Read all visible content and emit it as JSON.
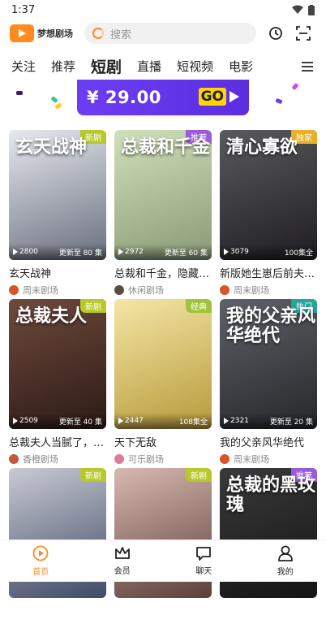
{
  "status": {
    "time": "1:37"
  },
  "header": {
    "logo_text": "梦想剧场",
    "search_placeholder": "搜索"
  },
  "tabs": [
    "关注",
    "推荐",
    "短剧",
    "直播",
    "短视频",
    "电影"
  ],
  "active_tab": "短剧",
  "banner": {
    "price": "¥ 29.00",
    "go_label": "GO"
  },
  "cards": [
    {
      "title": "玄天战神",
      "poster_text": "玄天战神",
      "badge": "新剧",
      "badge_type": "new",
      "views": "2800",
      "episodes": "更新至 80 集",
      "source": "周末剧场",
      "colors": [
        "#e6e9ef",
        "#6a6f7d"
      ],
      "avatar": "#d9532b"
    },
    {
      "title": "总裁和千金，隐藏身份",
      "poster_text": "总裁和千金",
      "badge": "推荐",
      "badge_type": "rec",
      "views": "2972",
      "episodes": "更新至 60 集",
      "source": "休闲剧场",
      "colors": [
        "#cfe0ba",
        "#8a9a76"
      ],
      "avatar": "#5a4a3f"
    },
    {
      "title": "新版她生崽后前夫却惊呆了",
      "poster_text": "清心寡欲",
      "badge": "独家",
      "badge_type": "excl",
      "views": "3079",
      "episodes": "100集全",
      "source": "周末剧场",
      "colors": [
        "#5a5a5e",
        "#1f1d21"
      ],
      "avatar": "#d9532b"
    },
    {
      "title": "总裁夫人当腻了，今天开始打脸",
      "poster_text": "总裁夫人",
      "badge": "新剧",
      "badge_type": "new",
      "views": "2509",
      "episodes": "更新至 40 集",
      "source": "香橙剧场",
      "colors": [
        "#6e4a3c",
        "#2c1a16"
      ],
      "avatar": "#c05a3a"
    },
    {
      "title": "天下无敌",
      "poster_text": "",
      "badge": "经典",
      "badge_type": "classic",
      "views": "2447",
      "episodes": "108集全",
      "source": "可乐剧场",
      "colors": [
        "#f4e6a6",
        "#b79a3a"
      ],
      "avatar": "#e07a9a"
    },
    {
      "title": "我的父亲风华绝代",
      "poster_text": "我的父亲风华绝代",
      "badge": "热门",
      "badge_type": "hot",
      "views": "2321",
      "episodes": "更新至 20 集",
      "source": "周末剧场",
      "colors": [
        "#5e6167",
        "#25272b"
      ],
      "avatar": "#d9532b"
    },
    {
      "title": "",
      "poster_text": "",
      "badge": "新剧",
      "badge_type": "new",
      "views": "",
      "episodes": "",
      "source": "",
      "colors": [
        "#c9cbd3",
        "#3f4a66"
      ],
      "avatar": "#888"
    },
    {
      "title": "",
      "poster_text": "",
      "badge": "新剧",
      "badge_type": "new",
      "views": "",
      "episodes": "",
      "source": "",
      "colors": [
        "#d7b9b0",
        "#5c3f3a"
      ],
      "avatar": "#888"
    },
    {
      "title": "",
      "poster_text": "总裁的黑玫瑰",
      "badge": "推荐",
      "badge_type": "rec",
      "views": "",
      "episodes": "",
      "source": "",
      "colors": [
        "#3a3a3c",
        "#141414"
      ],
      "avatar": "#888"
    }
  ],
  "bottom_nav": [
    {
      "label": "首页",
      "icon": "home-play-icon",
      "active": true
    },
    {
      "label": "会员",
      "icon": "crown-icon",
      "active": false
    },
    {
      "label": "聊天",
      "icon": "chat-icon",
      "active": false
    },
    {
      "label": "我的",
      "icon": "profile-icon",
      "active": false
    }
  ],
  "colors": {
    "accent": "#ff8a1f",
    "banner": "#6d3df5",
    "go": "#ffd400"
  }
}
